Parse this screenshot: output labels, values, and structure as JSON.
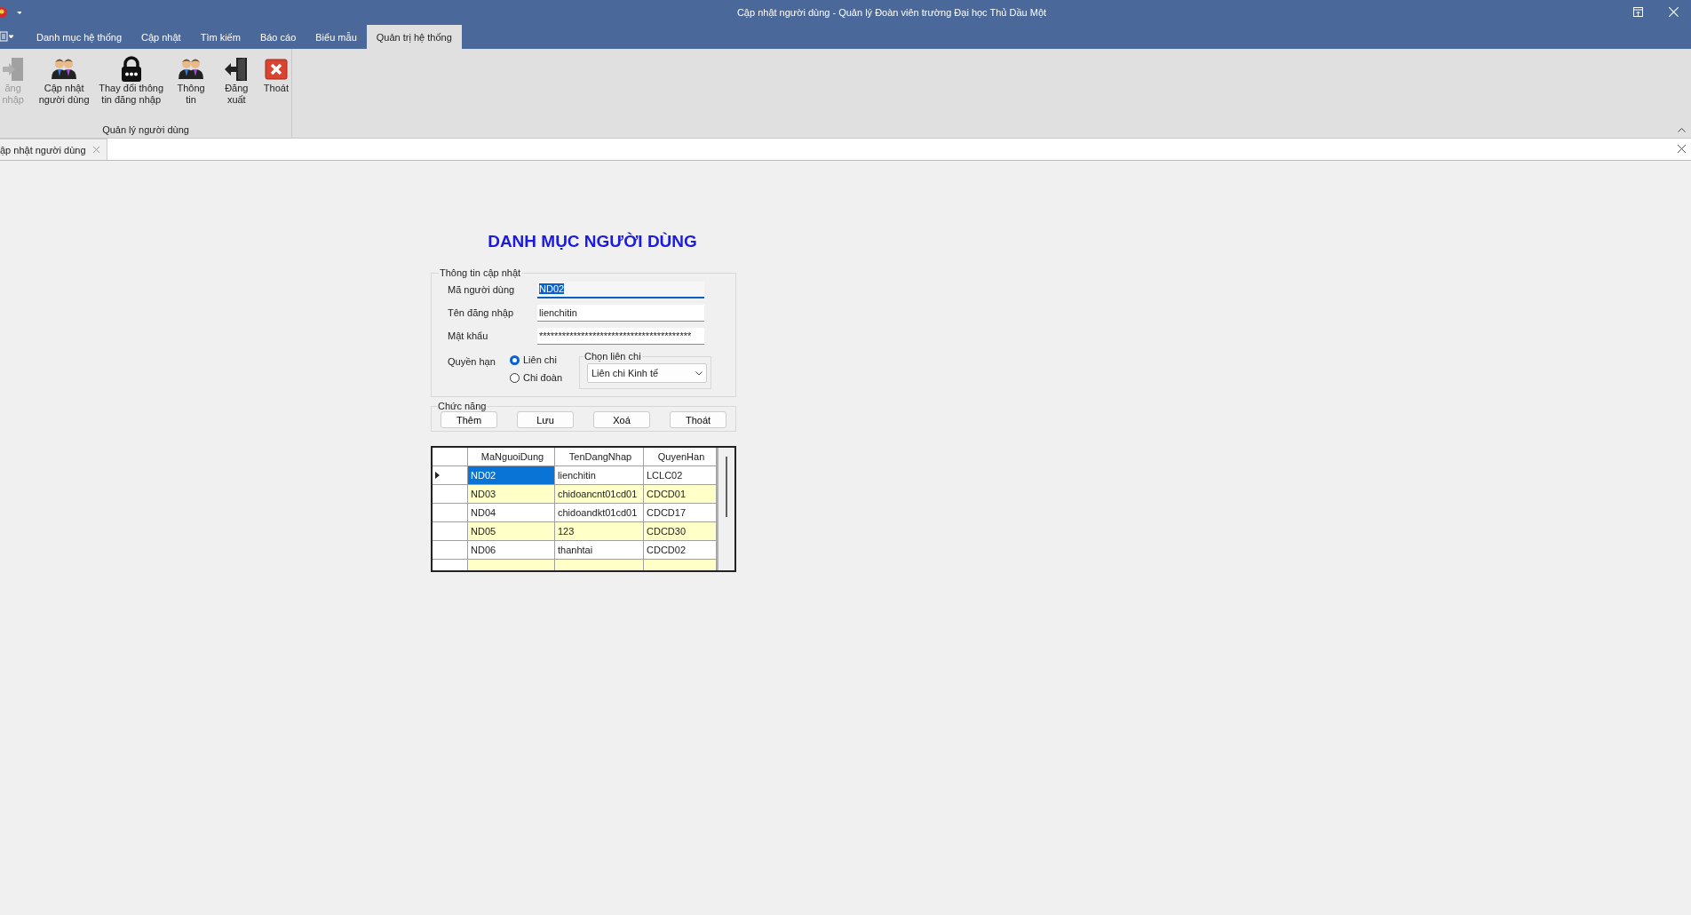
{
  "window": {
    "title": "Cập nhật người dùng - Quản lý Đoàn viên trường Đại học Thủ Dầu Một"
  },
  "ribbon_tabs": [
    {
      "label": "Danh mục hệ thống",
      "selected": false
    },
    {
      "label": "Cập nhật",
      "selected": false
    },
    {
      "label": "Tìm kiếm",
      "selected": false
    },
    {
      "label": "Báo cáo",
      "selected": false
    },
    {
      "label": "Biểu mẫu",
      "selected": false
    },
    {
      "label": "Quản trị hệ thống",
      "selected": true
    }
  ],
  "ribbon_group": {
    "label": "Quản lý người dùng",
    "buttons": [
      {
        "label": "ăng nhập",
        "kind": "login",
        "disabled": true
      },
      {
        "label": "Cập nhật người dùng",
        "kind": "users",
        "disabled": false
      },
      {
        "label": "Thay đổi thông tin đăng nhập",
        "kind": "lock",
        "disabled": false
      },
      {
        "label": "Thông tin",
        "kind": "users",
        "disabled": false
      },
      {
        "label": "Đăng xuất",
        "kind": "logout",
        "disabled": false
      },
      {
        "label": "Thoát",
        "kind": "exit",
        "disabled": false
      }
    ]
  },
  "document_tabs": [
    {
      "label": "ập nhật người dùng",
      "selected": true
    }
  ],
  "form": {
    "heading": "DANH MỤC NGƯỜI DÙNG",
    "info_group": {
      "legend": "Thông tin cập nhật",
      "fields": [
        {
          "label": "Mã người dùng",
          "value": "ND02",
          "focused": true
        },
        {
          "label": "Tên đăng nhập",
          "value": "lienchitin",
          "focused": false
        },
        {
          "label": "Mật khẩu",
          "value": "****************************************",
          "focused": false
        }
      ],
      "permission": {
        "label": "Quyền hạn",
        "options": [
          {
            "label": "Liên chi",
            "selected": true
          },
          {
            "label": "Chi đoàn",
            "selected": false
          }
        ]
      },
      "branch": {
        "legend": "Chọn liên chi",
        "value": "Liên chi Kinh tế"
      }
    },
    "actions": {
      "legend": "Chức năng",
      "buttons": [
        "Thêm",
        "Lưu",
        "Xoá",
        "Thoát"
      ]
    },
    "grid": {
      "columns": [
        "MaNguoiDung",
        "TenDangNhap",
        "QuyenHan"
      ],
      "rows": [
        {
          "cells": [
            "ND02",
            "lienchitin",
            "LCLC02"
          ],
          "selected": true
        },
        {
          "cells": [
            "ND03",
            "chidoancnt01cd01",
            "CDCD01"
          ],
          "selected": false
        },
        {
          "cells": [
            "ND04",
            "chidoandkt01cd01",
            "CDCD17"
          ],
          "selected": false
        },
        {
          "cells": [
            "ND05",
            "123",
            "CDCD30"
          ],
          "selected": false
        },
        {
          "cells": [
            "ND06",
            "thanhtai",
            "CDCD02"
          ],
          "selected": false
        }
      ]
    }
  }
}
